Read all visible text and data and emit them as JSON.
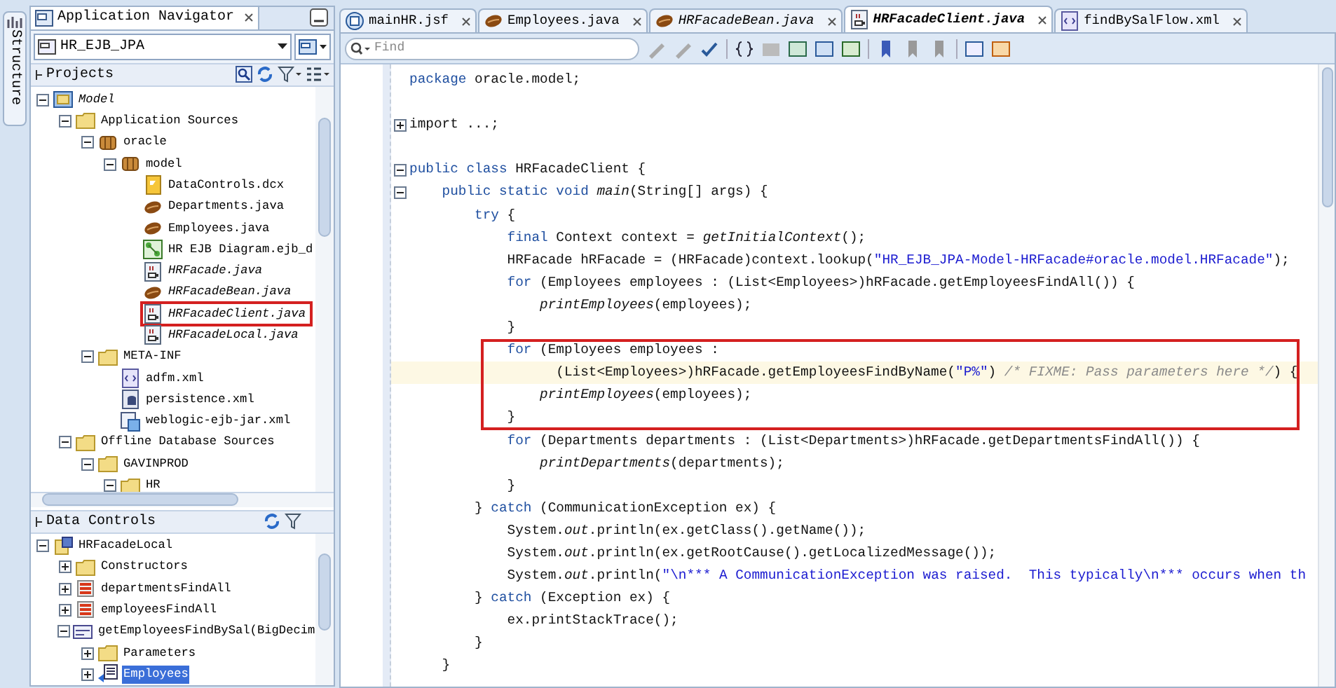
{
  "structure_tab": {
    "label": "Structure"
  },
  "navigator": {
    "title": "Application Navigator",
    "application": "HR_EJB_JPA",
    "projects": {
      "title": "Projects",
      "tree": [
        {
          "label": "Model",
          "kind": "project",
          "italic": true,
          "expanded": true,
          "children": [
            {
              "label": "Application Sources",
              "kind": "folder",
              "expanded": true,
              "children": [
                {
                  "label": "oracle",
                  "kind": "package",
                  "expanded": true,
                  "children": [
                    {
                      "label": "model",
                      "kind": "package",
                      "expanded": true,
                      "children": [
                        {
                          "label": "DataControls.dcx",
                          "kind": "dcx"
                        },
                        {
                          "label": "Departments.java",
                          "kind": "bean"
                        },
                        {
                          "label": "Employees.java",
                          "kind": "bean"
                        },
                        {
                          "label": "HR EJB Diagram.ejb_d",
                          "kind": "diagram"
                        },
                        {
                          "label": "HRFacade.java",
                          "kind": "java",
                          "italic": true
                        },
                        {
                          "label": "HRFacadeBean.java",
                          "kind": "bean",
                          "italic": true
                        },
                        {
                          "label": "HRFacadeClient.java",
                          "kind": "java",
                          "italic": true,
                          "annotated": true
                        },
                        {
                          "label": "HRFacadeLocal.java",
                          "kind": "java",
                          "italic": true
                        }
                      ]
                    }
                  ]
                },
                {
                  "label": "META-INF",
                  "kind": "folder",
                  "expanded": true,
                  "children": [
                    {
                      "label": "adfm.xml",
                      "kind": "xml"
                    },
                    {
                      "label": "persistence.xml",
                      "kind": "persistence"
                    },
                    {
                      "label": "weblogic-ejb-jar.xml",
                      "kind": "weblogic"
                    }
                  ]
                }
              ]
            },
            {
              "label": "Offline Database Sources",
              "kind": "folder",
              "expanded": true,
              "children": [
                {
                  "label": "GAVINPROD",
                  "kind": "folder",
                  "expanded": true,
                  "children": [
                    {
                      "label": "HR",
                      "kind": "folder",
                      "expanded": true
                    }
                  ]
                }
              ]
            }
          ]
        }
      ]
    },
    "data_controls": {
      "title": "Data Controls",
      "tree": [
        {
          "label": "HRFacadeLocal",
          "kind": "datacontrol",
          "expanded": true,
          "children": [
            {
              "label": "Constructors",
              "kind": "folder",
              "expanded": false
            },
            {
              "label": "departmentsFindAll",
              "kind": "collection",
              "expanded": false
            },
            {
              "label": "employeesFindAll",
              "kind": "collection",
              "expanded": false
            },
            {
              "label": "getEmployeesFindBySal(BigDecim",
              "kind": "method",
              "expanded": true,
              "children": [
                {
                  "label": "Parameters",
                  "kind": "folder",
                  "expanded": false
                },
                {
                  "label": "Employees",
                  "kind": "return",
                  "expanded": false,
                  "selected": true
                }
              ]
            }
          ]
        }
      ]
    }
  },
  "editor": {
    "tabs": [
      {
        "label": "mainHR.jsf",
        "kind": "page",
        "italic": false,
        "selected": false
      },
      {
        "label": "Employees.java",
        "kind": "bean",
        "italic": false,
        "selected": false
      },
      {
        "label": "HRFacadeBean.java",
        "kind": "bean",
        "italic": true,
        "selected": false
      },
      {
        "label": "HRFacadeClient.java",
        "kind": "java",
        "italic": true,
        "selected": true
      },
      {
        "label": "findBySalFlow.xml",
        "kind": "xml",
        "italic": false,
        "selected": false
      }
    ],
    "find": {
      "placeholder": "Find"
    },
    "lines": [
      {
        "kind": "code",
        "tokens": [
          {
            "kind": "keyword",
            "text": "package"
          },
          {
            "kind": "text",
            "text": " oracle.model;"
          }
        ]
      },
      {
        "kind": "blank"
      },
      {
        "kind": "code",
        "expanded": false,
        "tokens": [
          {
            "kind": "text",
            "text": "import ...;"
          }
        ]
      },
      {
        "kind": "blank"
      },
      {
        "kind": "code",
        "expanded": true,
        "tokens": [
          {
            "kind": "keyword",
            "text": "public class"
          },
          {
            "kind": "text",
            "text": " HRFacadeClient {"
          }
        ]
      },
      {
        "kind": "code",
        "expanded": true,
        "tokens": [
          {
            "kind": "keyword",
            "text": "    public static void "
          },
          {
            "kind": "call",
            "text": "main"
          },
          {
            "kind": "text",
            "text": "(String[] args) {"
          }
        ]
      },
      {
        "kind": "code",
        "tokens": [
          {
            "kind": "keyword",
            "text": "        try"
          },
          {
            "kind": "text",
            "text": " {"
          }
        ]
      },
      {
        "kind": "code",
        "tokens": [
          {
            "kind": "keyword",
            "text": "            final"
          },
          {
            "kind": "text",
            "text": " Context context = "
          },
          {
            "kind": "call",
            "text": "getInitialContext"
          },
          {
            "kind": "text",
            "text": "();"
          }
        ]
      },
      {
        "kind": "code",
        "tokens": [
          {
            "kind": "text",
            "text": "            HRFacade hRFacade = (HRFacade)context.lookup("
          },
          {
            "kind": "string",
            "text": "\"HR_EJB_JPA-Model-HRFacade#oracle.model.HRFacade\""
          },
          {
            "kind": "text",
            "text": ");"
          }
        ]
      },
      {
        "kind": "code",
        "tokens": [
          {
            "kind": "keyword",
            "text": "            for"
          },
          {
            "kind": "text",
            "text": " (Employees employees : (List<Employees>)hRFacade.getEmployeesFindAll()) {"
          }
        ]
      },
      {
        "kind": "code",
        "tokens": [
          {
            "kind": "call",
            "text": "                printEmployees"
          },
          {
            "kind": "text",
            "text": "(employees);"
          }
        ]
      },
      {
        "kind": "code",
        "tokens": [
          {
            "kind": "text",
            "text": "            }"
          }
        ]
      },
      {
        "kind": "code",
        "annotated": true,
        "tokens": [
          {
            "kind": "keyword",
            "text": "            for"
          },
          {
            "kind": "text",
            "text": " (Employees employees :"
          }
        ]
      },
      {
        "kind": "code",
        "annotated": true,
        "current": true,
        "tokens": [
          {
            "kind": "text",
            "text": "                  (List<Employees>)hRFacade.getEmployeesFindByName("
          },
          {
            "kind": "string",
            "text": "\"P%\""
          },
          {
            "kind": "text",
            "text": ") "
          },
          {
            "kind": "comment",
            "text": "/* FIXME: Pass parameters here */"
          },
          {
            "kind": "text",
            "text": ") {"
          }
        ]
      },
      {
        "kind": "code",
        "annotated": true,
        "tokens": [
          {
            "kind": "call",
            "text": "                printEmployees"
          },
          {
            "kind": "text",
            "text": "(employees);"
          }
        ]
      },
      {
        "kind": "code",
        "annotated": true,
        "tokens": [
          {
            "kind": "text",
            "text": "            }"
          }
        ]
      },
      {
        "kind": "code",
        "tokens": [
          {
            "kind": "keyword",
            "text": "            for"
          },
          {
            "kind": "text",
            "text": " (Departments departments : (List<Departments>)hRFacade.getDepartmentsFindAll()) {"
          }
        ]
      },
      {
        "kind": "code",
        "tokens": [
          {
            "kind": "call",
            "text": "                printDepartments"
          },
          {
            "kind": "text",
            "text": "(departments);"
          }
        ]
      },
      {
        "kind": "code",
        "tokens": [
          {
            "kind": "text",
            "text": "            }"
          }
        ]
      },
      {
        "kind": "code",
        "tokens": [
          {
            "kind": "text",
            "text": "        } "
          },
          {
            "kind": "keyword",
            "text": "catch"
          },
          {
            "kind": "text",
            "text": " (CommunicationException ex) {"
          }
        ]
      },
      {
        "kind": "code",
        "tokens": [
          {
            "kind": "text",
            "text": "            System."
          },
          {
            "kind": "call",
            "text": "out"
          },
          {
            "kind": "text",
            "text": ".println(ex.getClass().getName());"
          }
        ]
      },
      {
        "kind": "code",
        "tokens": [
          {
            "kind": "text",
            "text": "            System."
          },
          {
            "kind": "call",
            "text": "out"
          },
          {
            "kind": "text",
            "text": ".println(ex.getRootCause().getLocalizedMessage());"
          }
        ]
      },
      {
        "kind": "code",
        "tokens": [
          {
            "kind": "text",
            "text": "            System."
          },
          {
            "kind": "call",
            "text": "out"
          },
          {
            "kind": "text",
            "text": ".println("
          },
          {
            "kind": "string",
            "text": "\"\\n*** A CommunicationException was raised.  This typically\\n*** occurs when th"
          }
        ]
      },
      {
        "kind": "code",
        "tokens": [
          {
            "kind": "text",
            "text": "        } "
          },
          {
            "kind": "keyword",
            "text": "catch"
          },
          {
            "kind": "text",
            "text": " (Exception ex) {"
          }
        ]
      },
      {
        "kind": "code",
        "tokens": [
          {
            "kind": "text",
            "text": "            ex.printStackTrace();"
          }
        ]
      },
      {
        "kind": "code",
        "tokens": [
          {
            "kind": "text",
            "text": "        }"
          }
        ]
      },
      {
        "kind": "code",
        "tokens": [
          {
            "kind": "text",
            "text": "    }"
          }
        ]
      }
    ]
  }
}
